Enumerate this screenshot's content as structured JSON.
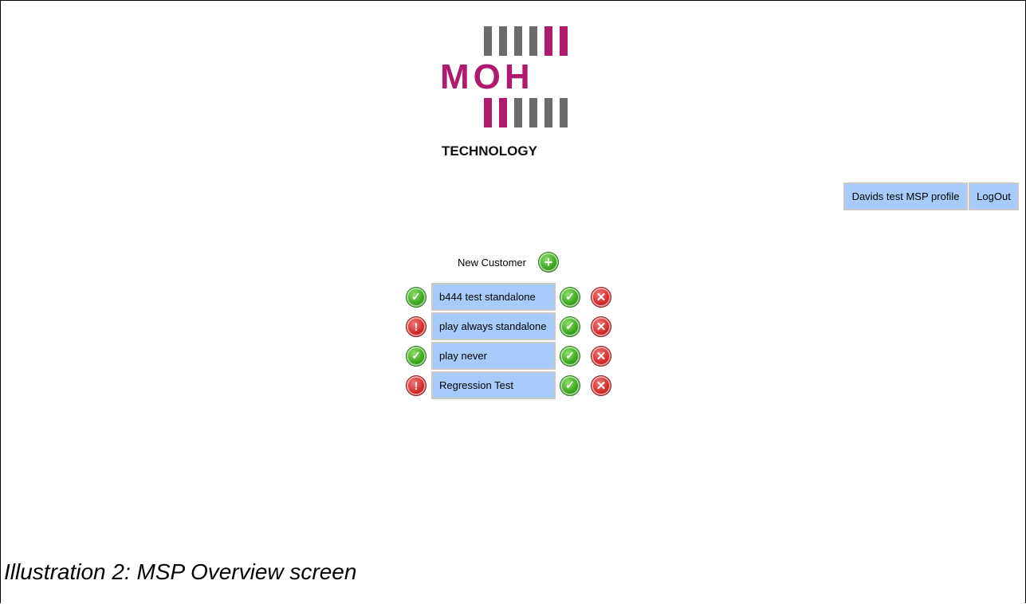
{
  "logo": {
    "main_text": "MOH",
    "sub_text": "TECHNOLOGY",
    "colors": {
      "magenta": "#b01a6c",
      "gray": "#6b6b6b"
    }
  },
  "header": {
    "profile_label": "Davids test MSP profile",
    "logout_label": "LogOut"
  },
  "new_customer": {
    "label": "New Customer",
    "icon": "plus-circle-icon"
  },
  "customers": [
    {
      "name": "b444 test standalone",
      "status": "ok"
    },
    {
      "name": "play always standalone",
      "status": "error"
    },
    {
      "name": "play never",
      "status": "ok"
    },
    {
      "name": "Regression Test",
      "status": "error"
    }
  ],
  "row_actions": {
    "edit_icon": "check-circle-icon",
    "delete_icon": "x-circle-icon"
  },
  "caption": "Illustration 2: MSP Overview screen",
  "colors": {
    "button_bg": "#a7ccfb",
    "button_border": "#c9c9c9",
    "ok": "#3aa61e",
    "error": "#d42a2a"
  }
}
